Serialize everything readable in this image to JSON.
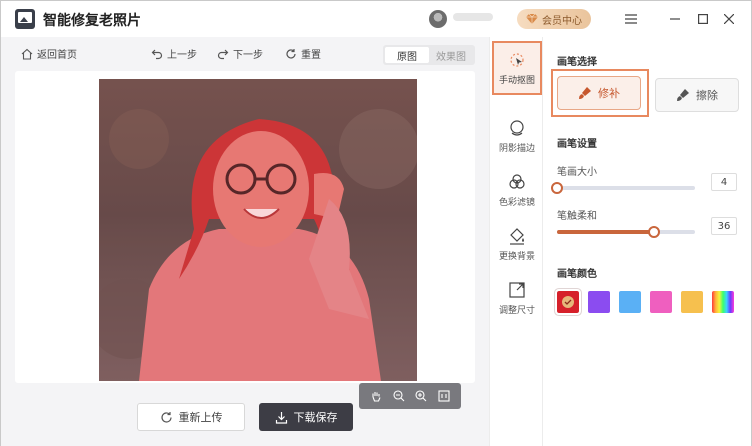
{
  "app": {
    "title": "智能修复老照片"
  },
  "header": {
    "vip_label": "会员中心"
  },
  "toolbar": {
    "back_label": "返回首页",
    "undo_label": "上一步",
    "redo_label": "下一步",
    "reset_label": "重置",
    "view_original": "原图",
    "view_result": "效果图"
  },
  "actions": {
    "reupload_label": "重新上传",
    "download_label": "下载保存"
  },
  "tools": [
    {
      "label": "手动抠图",
      "icon": "cursor-click-icon"
    },
    {
      "label": "阴影描边",
      "icon": "shadow-outline-icon"
    },
    {
      "label": "色彩滤镜",
      "icon": "color-filter-icon"
    },
    {
      "label": "更换背景",
      "icon": "paint-bucket-icon"
    },
    {
      "label": "调整尺寸",
      "icon": "resize-icon"
    }
  ],
  "panel": {
    "brush_select_title": "画笔选择",
    "brush_repair_label": "修补",
    "brush_erase_label": "擦除",
    "brush_settings_title": "画笔设置",
    "brush_size_label": "笔画大小",
    "brush_size_value": "4",
    "brush_size_fraction": 0.0,
    "brush_soft_label": "笔触柔和",
    "brush_soft_value": "36",
    "brush_soft_fraction": 0.7,
    "brush_color_title": "画笔颜色",
    "colors": [
      "#d6202a",
      "#8b4cf0",
      "#5ab0f5",
      "#ef5fbf",
      "#f6c04e",
      "rainbow"
    ]
  }
}
